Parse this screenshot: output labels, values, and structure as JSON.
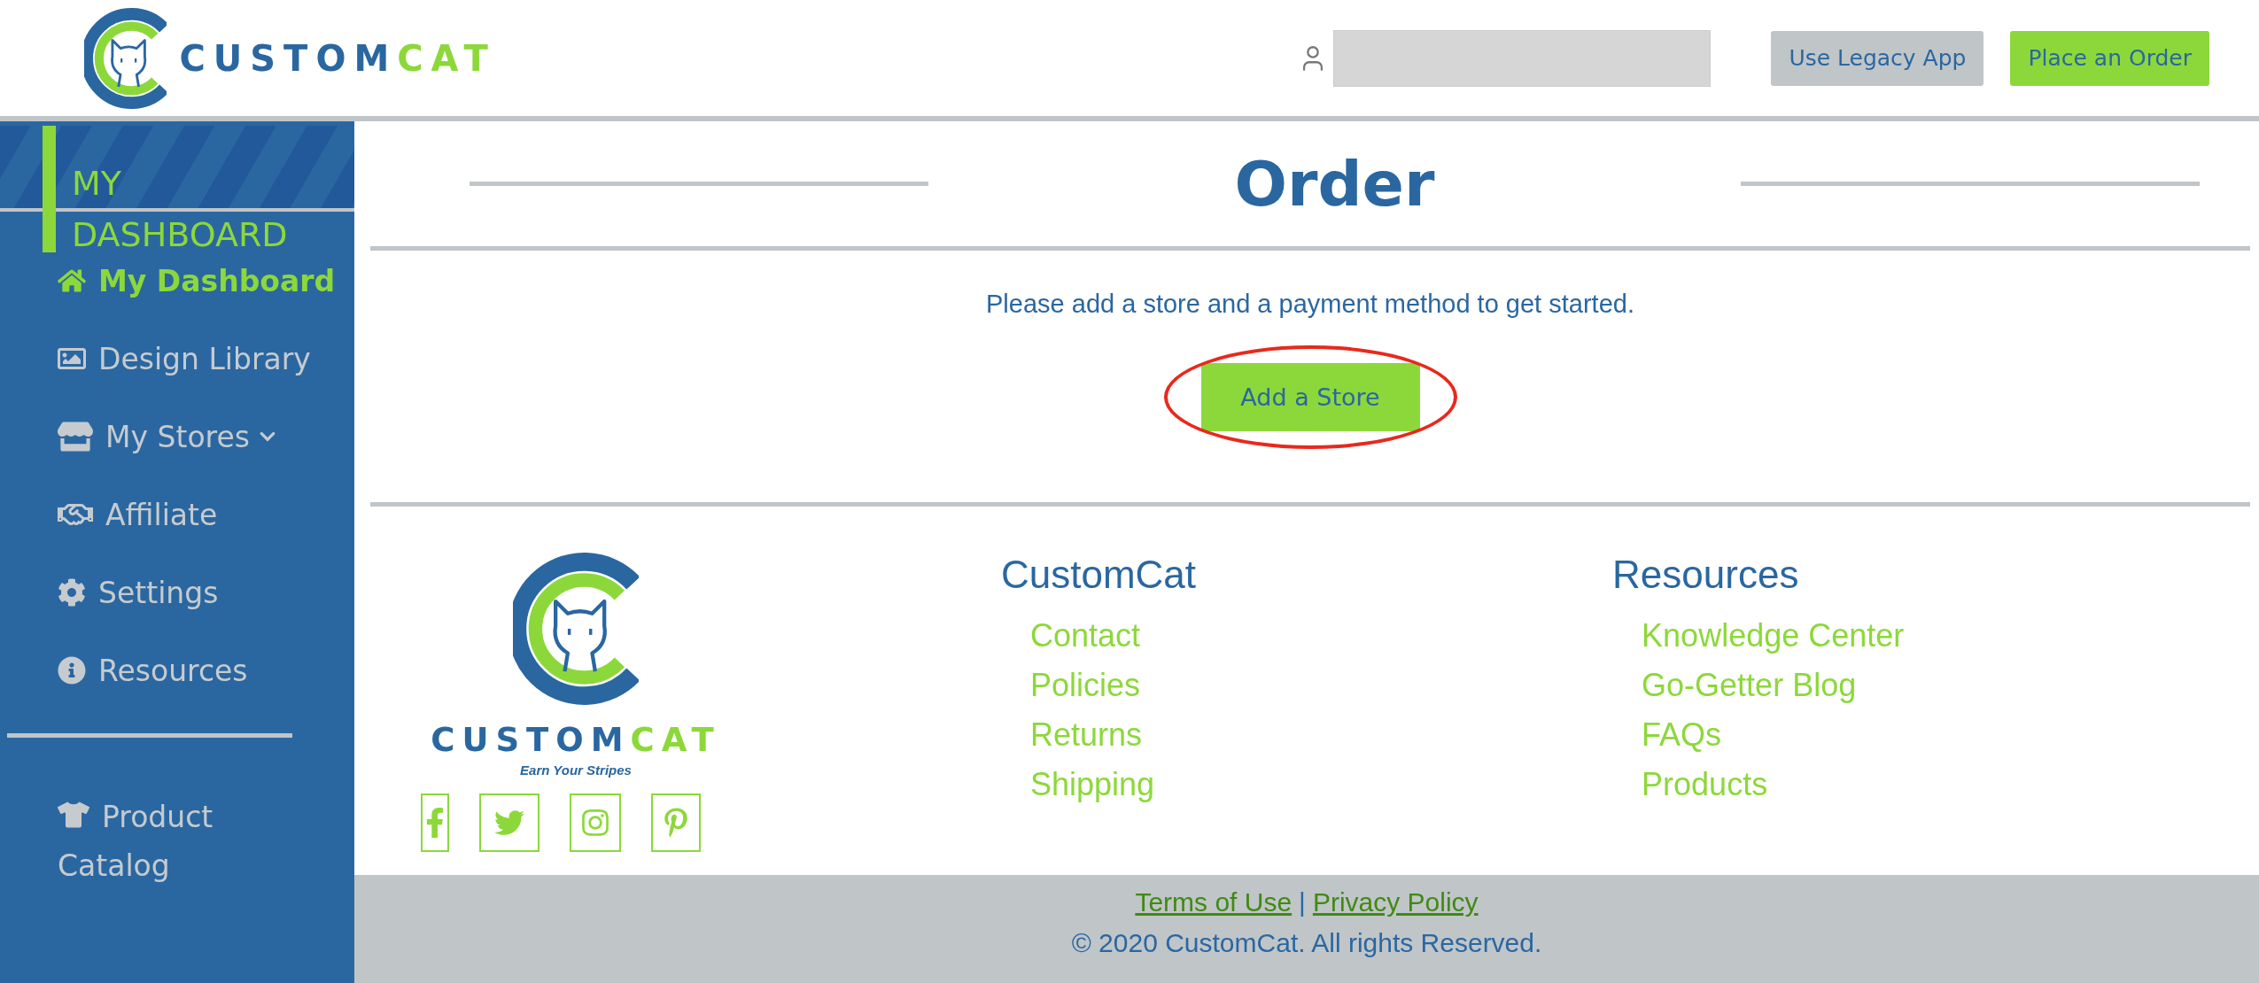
{
  "header": {
    "logo": {
      "word_1": "CUSTOM",
      "word_2": "CAT"
    },
    "buttons": [
      {
        "label": "Use Legacy App",
        "kind": "secondary"
      },
      {
        "label": "Place an Order",
        "kind": "primary"
      }
    ]
  },
  "sidebar": {
    "title": "MY DASHBOARD",
    "items": [
      {
        "label": "My Dashboard",
        "selected": true,
        "kind": "link"
      },
      {
        "label": "Design Library",
        "selected": false,
        "kind": "link"
      },
      {
        "label": "My Stores",
        "selected": false,
        "kind": "dropdown",
        "expanded": false
      },
      {
        "label": "Affiliate",
        "selected": false,
        "kind": "link"
      },
      {
        "label": "Settings",
        "selected": false,
        "kind": "link"
      },
      {
        "label": "Resources",
        "selected": false,
        "kind": "link"
      }
    ],
    "catalog": {
      "label": "Product Catalog",
      "selected": false
    }
  },
  "page": {
    "title": "Order",
    "message": "Please add a store and a payment method to get started.",
    "button": {
      "label": "Add a Store",
      "highlighted": true
    }
  },
  "footer": {
    "logo": {
      "word_1": "CUSTOM",
      "word_2": "CAT",
      "tagline": "Earn Your Stripes"
    },
    "columns": [
      {
        "heading": "CustomCat",
        "links": [
          "Contact",
          "Policies",
          "Returns",
          "Shipping"
        ]
      },
      {
        "heading": "Resources",
        "links": [
          "Knowledge Center",
          "Go-Getter Blog",
          "FAQs",
          "Products"
        ]
      }
    ],
    "legal_links": [
      "Terms of Use",
      "Privacy Policy"
    ],
    "separator": "|",
    "copyright": "© 2020 CustomCat. All rights Reserved."
  }
}
